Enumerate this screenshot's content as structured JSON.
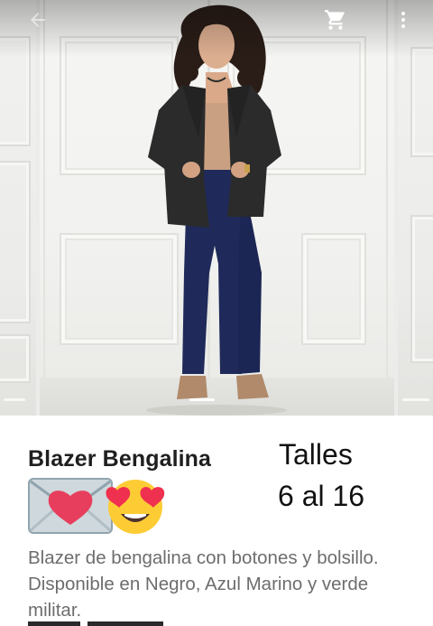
{
  "toolbar": {
    "back_icon": "arrow-back-icon",
    "cart_icon": "shopping-cart-icon",
    "more_icon": "more-vertical-icon",
    "icon_color": "#ffffff"
  },
  "carousel": {
    "slide_count": 3,
    "active_index": 1
  },
  "product": {
    "title": "Blazer Bengalina",
    "title_emojis": [
      "love-letter-emoji",
      "heart-eyes-emoji"
    ],
    "sizes_label": "Talles",
    "sizes_range": "6 al 16",
    "description": "Blazer de bengalina con botones y bolsillo. Disponible en Negro, Azul Marino y verde militar."
  },
  "colors": {
    "title": "#1f1f1f",
    "description": "#6d6d6d",
    "sizes": "#111111"
  }
}
